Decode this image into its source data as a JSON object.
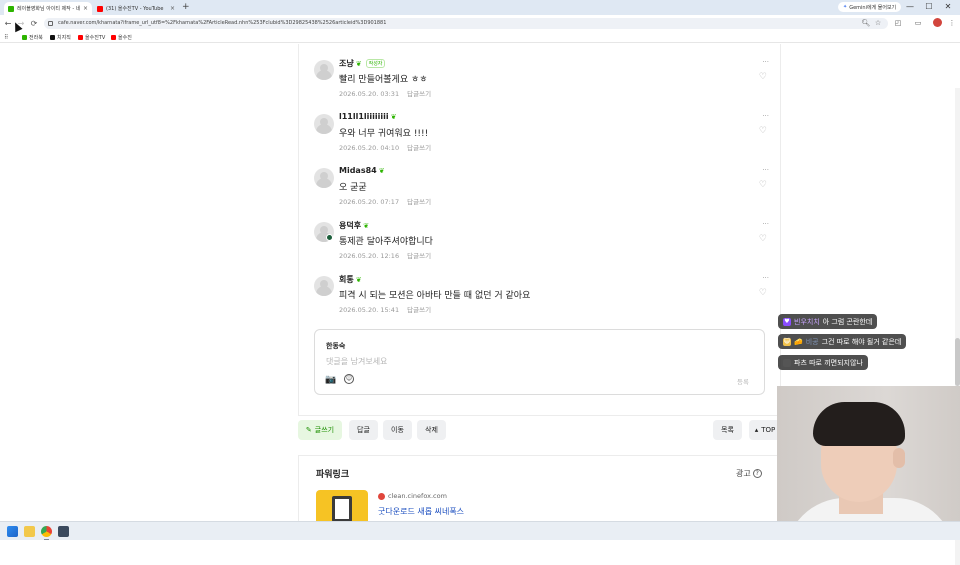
{
  "browser": {
    "tabs": [
      {
        "title": "레이블영화님 아이티 제작 - 네",
        "favicon_color": "#2db400",
        "active": true
      },
      {
        "title": "(31) 을수진TV - YouTube",
        "favicon_color": "#ff0000",
        "active": false
      }
    ],
    "new_tab": "+",
    "gemini_label": "Gemini에게 물어보기",
    "window_controls": {
      "minimize": "—",
      "maximize": "☐",
      "close": "✕"
    },
    "url": "cafe.naver.com/kharnata?iframe_url_utf8=%2Fkharnata%2FArticleRead.nhn%253Fclubid%3D29825438%2526articleid%3D901881",
    "nav": {
      "back": "←",
      "forward": "→",
      "reload": "⟳"
    },
    "bookmarks": [
      {
        "label": "전라북",
        "color": "#2db400"
      },
      {
        "label": "치지직",
        "color": "#111111"
      },
      {
        "label": "을수진TV",
        "color": "#ff0000"
      },
      {
        "label": "을수진",
        "color": "#ff0000"
      }
    ]
  },
  "comments": [
    {
      "name": "조냥",
      "writer_tag": "작성자",
      "text": "빨리 만들어볼게요 ㅎㅎ",
      "date": "2026.05.20. 03:31",
      "reply": "답글쓰기"
    },
    {
      "name": "l11ll1liiiiiiii",
      "writer_tag": "",
      "text": "우와 너무 귀여워요 !!!!",
      "date": "2026.05.20. 04:10",
      "reply": "답글쓰기"
    },
    {
      "name": "Midas84",
      "writer_tag": "",
      "text": "오 굳굳",
      "date": "2026.05.20. 07:17",
      "reply": "답글쓰기"
    },
    {
      "name": "용덕후",
      "writer_tag": "",
      "text": "통제관 달아주셔야합니다",
      "date": "2026.05.20. 12:16",
      "reply": "답글쓰기"
    },
    {
      "name": "회통",
      "writer_tag": "",
      "text": "피격 시 되는 모션은 아바타 만들 때 없던 거 같아요",
      "date": "2026.05.20. 15:41",
      "reply": "답글쓰기"
    }
  ],
  "comment_icons": {
    "more": "···",
    "heart": "♡",
    "leaf": "❦"
  },
  "write_box": {
    "user": "한동숙",
    "placeholder": "댓글을 남겨보세요",
    "camera_icon": "📷",
    "emoji_icon": "☺",
    "submit": "등록"
  },
  "actions": {
    "write": "글쓰기",
    "reply": "답글",
    "move": "이동",
    "delete": "삭제",
    "list": "목록",
    "top": "TOP"
  },
  "powerlink": {
    "title": "파워링크",
    "ad_label": "광고",
    "ad_help": "?",
    "domain": "clean.cinefox.com",
    "headline": "굿다운로드 새롭 씨네폭스"
  },
  "stream_chat": [
    {
      "badge": "♥",
      "badge_color": "#8a4dff",
      "nick": "빈우치치",
      "nick_style": "purple",
      "message": "아 그럼 곤란한데"
    },
    {
      "badge": "😺",
      "badge_color": "#f0c14b",
      "nick": "비공",
      "nick_style": "blue",
      "message": "그건 따로 해야 될거 같은데"
    },
    {
      "badge": "",
      "badge_color": "#555555",
      "nick": "",
      "nick_style": "",
      "message": "파츠 따로 끼면되지않나"
    }
  ]
}
